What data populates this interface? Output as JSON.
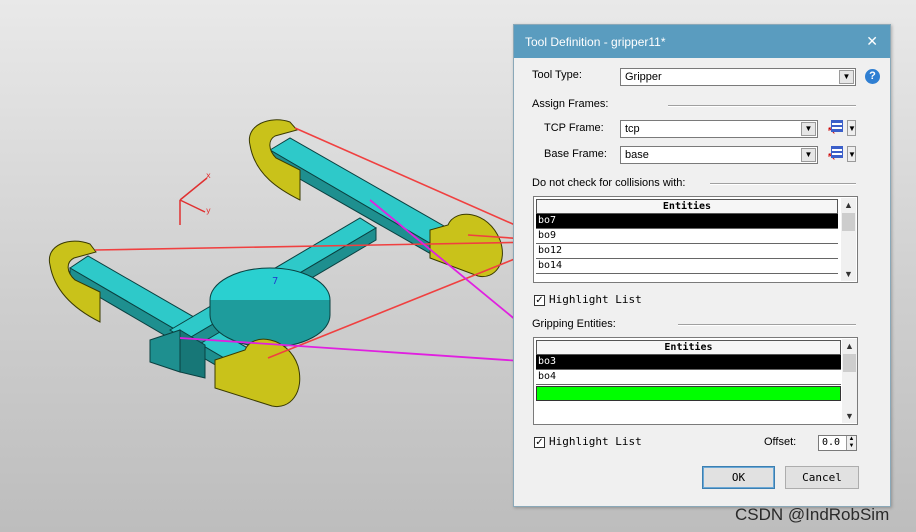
{
  "dialog": {
    "title": "Tool Definition - gripper11*",
    "close_glyph": "✕",
    "tool_type_label": "Tool Type:",
    "tool_type_value": "Gripper",
    "help_glyph": "?",
    "assign_frames_label": "Assign Frames:",
    "tcp_frame_label": "TCP Frame:",
    "tcp_frame_value": "tcp",
    "base_frame_label": "Base Frame:",
    "base_frame_value": "base",
    "collision_label": "Do not check for collisions with:",
    "collision_list": {
      "header": "Entities",
      "rows": [
        "bo7",
        "bo9",
        "bo12",
        "bo14"
      ],
      "selected_index": 0
    },
    "highlight_list_1": {
      "label": "Highlight List",
      "checked": true
    },
    "gripping_label": "Gripping Entities:",
    "gripping_list": {
      "header": "Entities",
      "rows": [
        "bo3",
        "bo4"
      ],
      "selected_index": 0,
      "green_row_present": true
    },
    "highlight_list_2": {
      "label": "Highlight List",
      "checked": true
    },
    "offset_label": "Offset:",
    "offset_value": "0.0",
    "ok_label": "OK",
    "cancel_label": "Cancel"
  },
  "scene": {
    "frame_axes": [
      "x",
      "y",
      "z"
    ],
    "frame_color": "#e03030",
    "gripper_body_color": "#2ec9c9",
    "gripper_finger_color": "#c9c21a",
    "arrow_red_color": "#f04040",
    "arrow_magenta_color": "#e020e0"
  },
  "watermark": "CSDN @IndRobSim",
  "colors": {
    "titlebar": "#5a9cbf",
    "selected_row": "#000000",
    "green_row": "#00ff00"
  }
}
